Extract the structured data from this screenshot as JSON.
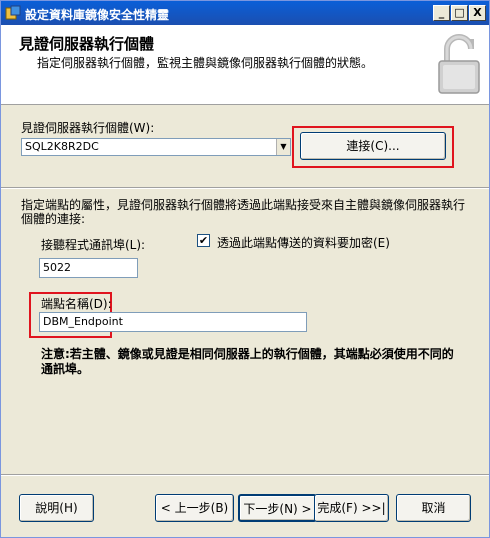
{
  "window": {
    "title": "設定資料庫鏡像安全性精靈",
    "controls": {
      "minimize": "_",
      "maximize": "□",
      "close": "X"
    }
  },
  "header": {
    "title": "見證伺服器執行個體",
    "subtitle": "指定伺服器執行個體，監視主體與鏡像伺服器執行個體的狀態。",
    "icon": "padlock-icon"
  },
  "instance": {
    "label": "見證伺服器執行個體(W):",
    "selected": "SQL2K8R2DC",
    "connect_button": "連接(C)..."
  },
  "endpoint": {
    "description": "指定端點的屬性，見證伺服器執行個體將透過此端點接受來自主體與鏡像伺服器執行個體的連接:",
    "port_label": "接聽程式通訊埠(L):",
    "port_value": "5022",
    "encrypt_label": "透過此端點傳送的資料要加密(E)",
    "encrypt_checked": "✔",
    "name_label": "端點名稱(D):",
    "name_value": "DBM_Endpoint"
  },
  "note": "注意:若主體、鏡像或見證是相同伺服器上的執行個體，其端點必須使用不同的通訊埠。",
  "buttons": {
    "help": "說明(H)",
    "back": "< 上一步(B)",
    "next": "下一步(N) >",
    "finish": "完成(F) >>|",
    "cancel": "取消"
  },
  "colors": {
    "highlight": "#e0141e",
    "titlebar": "#0a5fd8"
  }
}
